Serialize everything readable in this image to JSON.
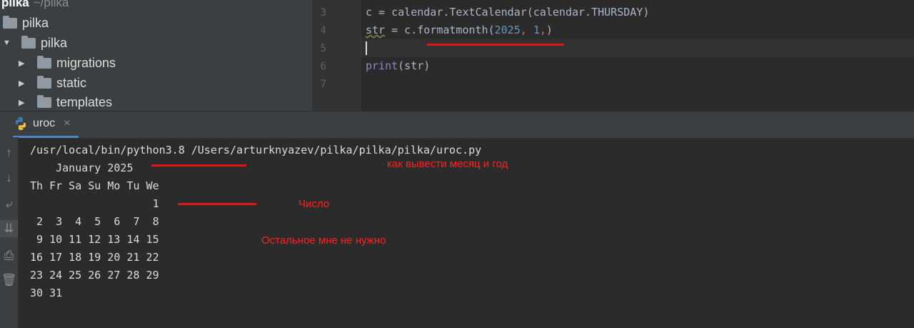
{
  "project_tree": {
    "project_name": "pilka",
    "project_path": "~/pilka",
    "items": [
      {
        "label": "pilka"
      },
      {
        "label": "pilka"
      },
      {
        "label": "migrations"
      },
      {
        "label": "static"
      },
      {
        "label": "templates"
      }
    ]
  },
  "editor": {
    "lines": [
      {
        "number": "3",
        "code": "c = calendar.TextCalendar(calendar.THURSDAY)"
      },
      {
        "number": "4",
        "var": "str",
        "eq": " = c.formatmonth(",
        "arg1": "2025",
        "comma1": ", ",
        "arg2": "1",
        "comma2": ",",
        "close": ")"
      },
      {
        "number": "5",
        "code": ""
      },
      {
        "number": "6",
        "fn": "print",
        "rest": "(str)"
      },
      {
        "number": "7",
        "code": ""
      }
    ]
  },
  "run_window": {
    "tab_label": "uroc",
    "close_glyph": "×",
    "console_lines": [
      "/usr/local/bin/python3.8 /Users/arturknyazev/pilka/pilka/pilka/uroc.py",
      "    January 2025",
      "Th Fr Sa Su Mo Tu We",
      "                   1",
      " 2  3  4  5  6  7  8",
      " 9 10 11 12 13 14 15",
      "16 17 18 19 20 21 22",
      "23 24 25 26 27 28 29",
      "30 31"
    ],
    "side_tools": [
      "arrow-up-icon",
      "arrow-down-icon",
      "soft-wrap-icon",
      "scroll-to-end-icon",
      "print-icon",
      "trash-icon"
    ]
  },
  "annotations": {
    "note_month_year": "как вывести месяц и год",
    "note_number": "Число",
    "note_rest": "Остальное мне не нужно",
    "color": "#e31515"
  }
}
